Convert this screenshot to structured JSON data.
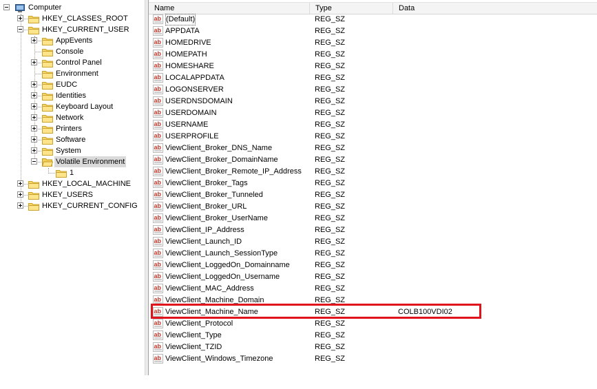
{
  "tree": {
    "root": "Computer",
    "hives": [
      "HKEY_CLASSES_ROOT",
      "HKEY_CURRENT_USER",
      "HKEY_LOCAL_MACHINE",
      "HKEY_USERS",
      "HKEY_CURRENT_CONFIG"
    ],
    "hkcu_children": [
      "AppEvents",
      "Console",
      "Control Panel",
      "Environment",
      "EUDC",
      "Identities",
      "Keyboard Layout",
      "Network",
      "Printers",
      "Software",
      "System",
      "Volatile Environment"
    ],
    "volatile_child": "1"
  },
  "list": {
    "columns": {
      "name": "Name",
      "type": "Type",
      "data": "Data"
    },
    "rows": [
      {
        "name": "(Default)",
        "type": "REG_SZ",
        "data": ""
      },
      {
        "name": "APPDATA",
        "type": "REG_SZ",
        "data": ""
      },
      {
        "name": "HOMEDRIVE",
        "type": "REG_SZ",
        "data": ""
      },
      {
        "name": "HOMEPATH",
        "type": "REG_SZ",
        "data": ""
      },
      {
        "name": "HOMESHARE",
        "type": "REG_SZ",
        "data": ""
      },
      {
        "name": "LOCALAPPDATA",
        "type": "REG_SZ",
        "data": ""
      },
      {
        "name": "LOGONSERVER",
        "type": "REG_SZ",
        "data": ""
      },
      {
        "name": "USERDNSDOMAIN",
        "type": "REG_SZ",
        "data": ""
      },
      {
        "name": "USERDOMAIN",
        "type": "REG_SZ",
        "data": ""
      },
      {
        "name": "USERNAME",
        "type": "REG_SZ",
        "data": ""
      },
      {
        "name": "USERPROFILE",
        "type": "REG_SZ",
        "data": ""
      },
      {
        "name": "ViewClient_Broker_DNS_Name",
        "type": "REG_SZ",
        "data": ""
      },
      {
        "name": "ViewClient_Broker_DomainName",
        "type": "REG_SZ",
        "data": ""
      },
      {
        "name": "ViewClient_Broker_Remote_IP_Address",
        "type": "REG_SZ",
        "data": ""
      },
      {
        "name": "ViewClient_Broker_Tags",
        "type": "REG_SZ",
        "data": ""
      },
      {
        "name": "ViewClient_Broker_Tunneled",
        "type": "REG_SZ",
        "data": ""
      },
      {
        "name": "ViewClient_Broker_URL",
        "type": "REG_SZ",
        "data": ""
      },
      {
        "name": "ViewClient_Broker_UserName",
        "type": "REG_SZ",
        "data": ""
      },
      {
        "name": "ViewClient_IP_Address",
        "type": "REG_SZ",
        "data": ""
      },
      {
        "name": "ViewClient_Launch_ID",
        "type": "REG_SZ",
        "data": ""
      },
      {
        "name": "ViewClient_Launch_SessionType",
        "type": "REG_SZ",
        "data": ""
      },
      {
        "name": "ViewClient_LoggedOn_Domainname",
        "type": "REG_SZ",
        "data": ""
      },
      {
        "name": "ViewClient_LoggedOn_Username",
        "type": "REG_SZ",
        "data": ""
      },
      {
        "name": "ViewClient_MAC_Address",
        "type": "REG_SZ",
        "data": ""
      },
      {
        "name": "ViewClient_Machine_Domain",
        "type": "REG_SZ",
        "data": ""
      },
      {
        "name": "ViewClient_Machine_Name",
        "type": "REG_SZ",
        "data": "COLB100VDI02"
      },
      {
        "name": "ViewClient_Protocol",
        "type": "REG_SZ",
        "data": ""
      },
      {
        "name": "ViewClient_Type",
        "type": "REG_SZ",
        "data": ""
      },
      {
        "name": "ViewClient_TZID",
        "type": "REG_SZ",
        "data": ""
      },
      {
        "name": "ViewClient_Windows_Timezone",
        "type": "REG_SZ",
        "data": ""
      }
    ]
  },
  "colors": {
    "highlight_border": "#e0121b",
    "selected_bg": "#dadada"
  },
  "icons": {
    "folder": "folder-icon",
    "value": "string-value-icon",
    "computer": "computer-icon"
  }
}
